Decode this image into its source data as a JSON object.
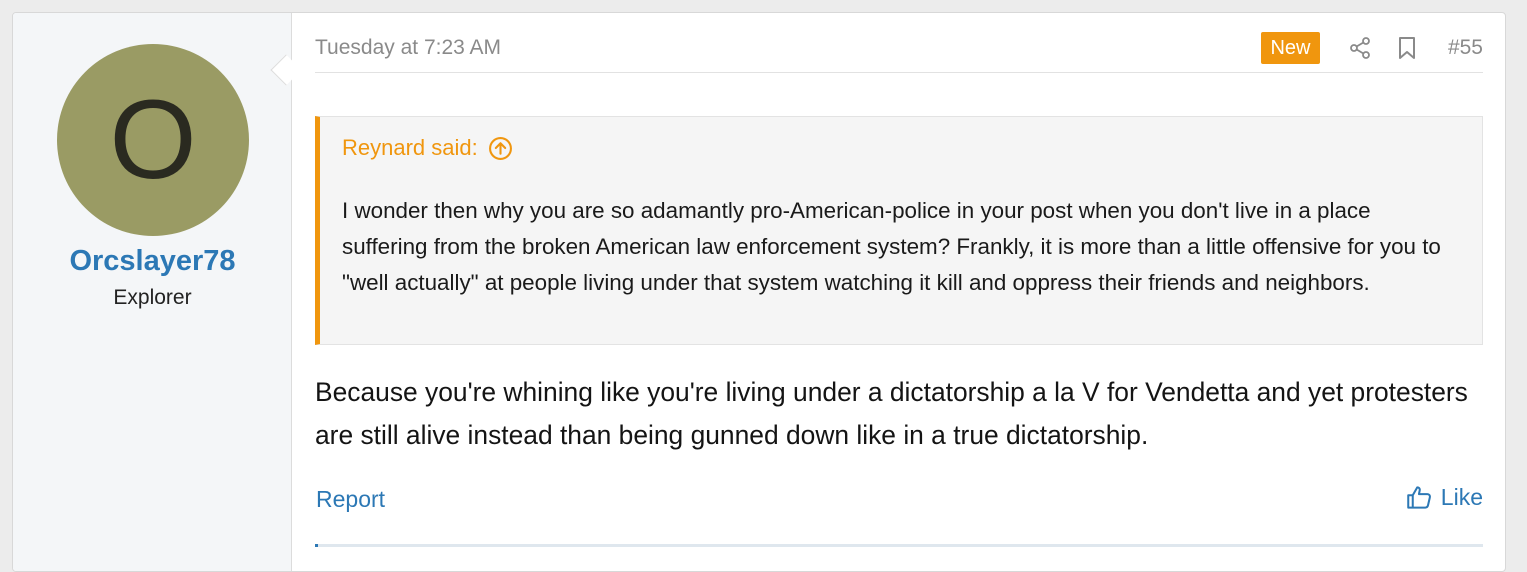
{
  "post": {
    "author": {
      "avatar_letter": "O",
      "avatar_color": "#9a9b64",
      "username": "Orcslayer78",
      "user_title": "Explorer"
    },
    "meta": {
      "timestamp": "Tuesday at 7:23 AM",
      "badge": "New",
      "post_number": "#55",
      "icons": [
        "share-icon",
        "bookmark-icon"
      ]
    },
    "quote": {
      "attribution": "Reynard said:",
      "icon": "arrow-up-circle-icon",
      "text": "I wonder then why you are so adamantly pro-American-police in your post when you don't live in a place suffering from the broken American law enforcement system? Frankly, it is more than a little offensive for you to \"well actually\" at people living under that system watching it kill and oppress their friends and neighbors."
    },
    "message": "Because you're whining like you're living under a dictatorship a la V for Vendetta and yet protesters are still alive instead than being gunned down like in a true dictatorship.",
    "actions": {
      "report_label": "Report",
      "like_label": "Like",
      "like_icon": "thumbs-up-icon"
    }
  },
  "colors": {
    "accent_orange": "#f0960e",
    "link_blue": "#2c78b5"
  }
}
